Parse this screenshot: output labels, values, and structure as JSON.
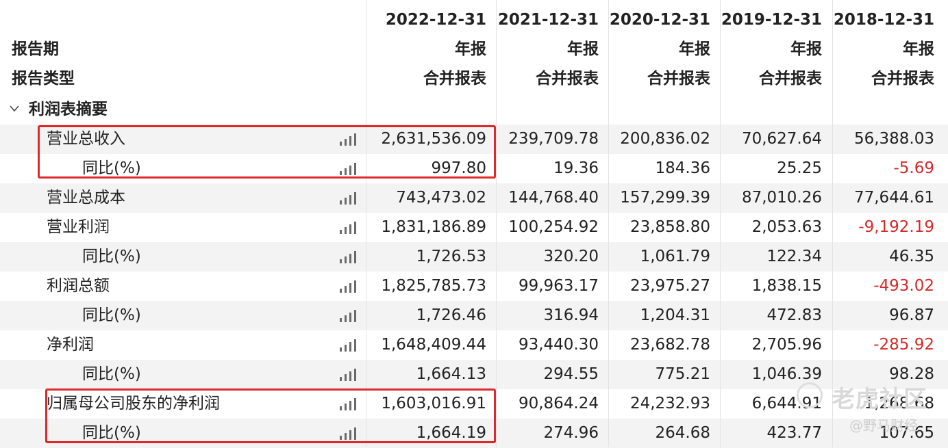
{
  "header": {
    "dates": [
      "2022-12-31",
      "2021-12-31",
      "2020-12-31",
      "2019-12-31",
      "2018-12-31"
    ],
    "period_label": "报告期",
    "period_values": [
      "年报",
      "年报",
      "年报",
      "年报",
      "年报"
    ],
    "type_label": "报告类型",
    "type_values": [
      "合并报表",
      "合并报表",
      "合并报表",
      "合并报表",
      "合并报表"
    ]
  },
  "section": {
    "title": "利润表摘要",
    "icon": "chevron-down-icon"
  },
  "rows": [
    {
      "label": "营业总收入",
      "indent": 1,
      "values": [
        "2,631,536.09",
        "239,709.78",
        "200,836.02",
        "70,627.64",
        "56,388.03"
      ]
    },
    {
      "label": "同比(%)",
      "indent": 2,
      "values": [
        "997.80",
        "19.36",
        "184.36",
        "25.25",
        "-5.69"
      ]
    },
    {
      "label": "营业总成本",
      "indent": 1,
      "values": [
        "743,473.02",
        "144,768.40",
        "157,299.39",
        "87,010.26",
        "77,644.61"
      ]
    },
    {
      "label": "营业利润",
      "indent": 1,
      "values": [
        "1,831,186.89",
        "100,254.92",
        "23,858.80",
        "2,053.63",
        "-9,192.19"
      ]
    },
    {
      "label": "同比(%)",
      "indent": 2,
      "values": [
        "1,726.53",
        "320.20",
        "1,061.79",
        "122.34",
        "46.35"
      ]
    },
    {
      "label": "利润总额",
      "indent": 1,
      "values": [
        "1,825,785.73",
        "99,963.17",
        "23,975.27",
        "1,838.15",
        "-493.02"
      ]
    },
    {
      "label": "同比(%)",
      "indent": 2,
      "values": [
        "1,726.46",
        "316.94",
        "1,204.31",
        "472.83",
        "96.87"
      ]
    },
    {
      "label": "净利润",
      "indent": 1,
      "values": [
        "1,648,409.44",
        "93,440.30",
        "23,682.78",
        "2,705.96",
        "-285.92"
      ]
    },
    {
      "label": "同比(%)",
      "indent": 2,
      "values": [
        "1,664.13",
        "294.55",
        "775.21",
        "1,046.39",
        "98.28"
      ]
    },
    {
      "label": "归属母公司股东的净利润",
      "indent": 1,
      "values": [
        "1,603,016.91",
        "90,864.24",
        "24,232.93",
        "6,644.91",
        "1,268.68"
      ]
    },
    {
      "label": "同比(%)",
      "indent": 2,
      "values": [
        "1,664.19",
        "274.96",
        "264.68",
        "423.77",
        "107.65"
      ]
    }
  ],
  "chart_icon": "bar-chart-icon",
  "colors": {
    "negative": "#d42a2a",
    "highlight": "#e0282a",
    "row_shade": "#f3f3f3"
  },
  "watermark": {
    "brand": "老虎社区",
    "author": "@野马财经"
  }
}
